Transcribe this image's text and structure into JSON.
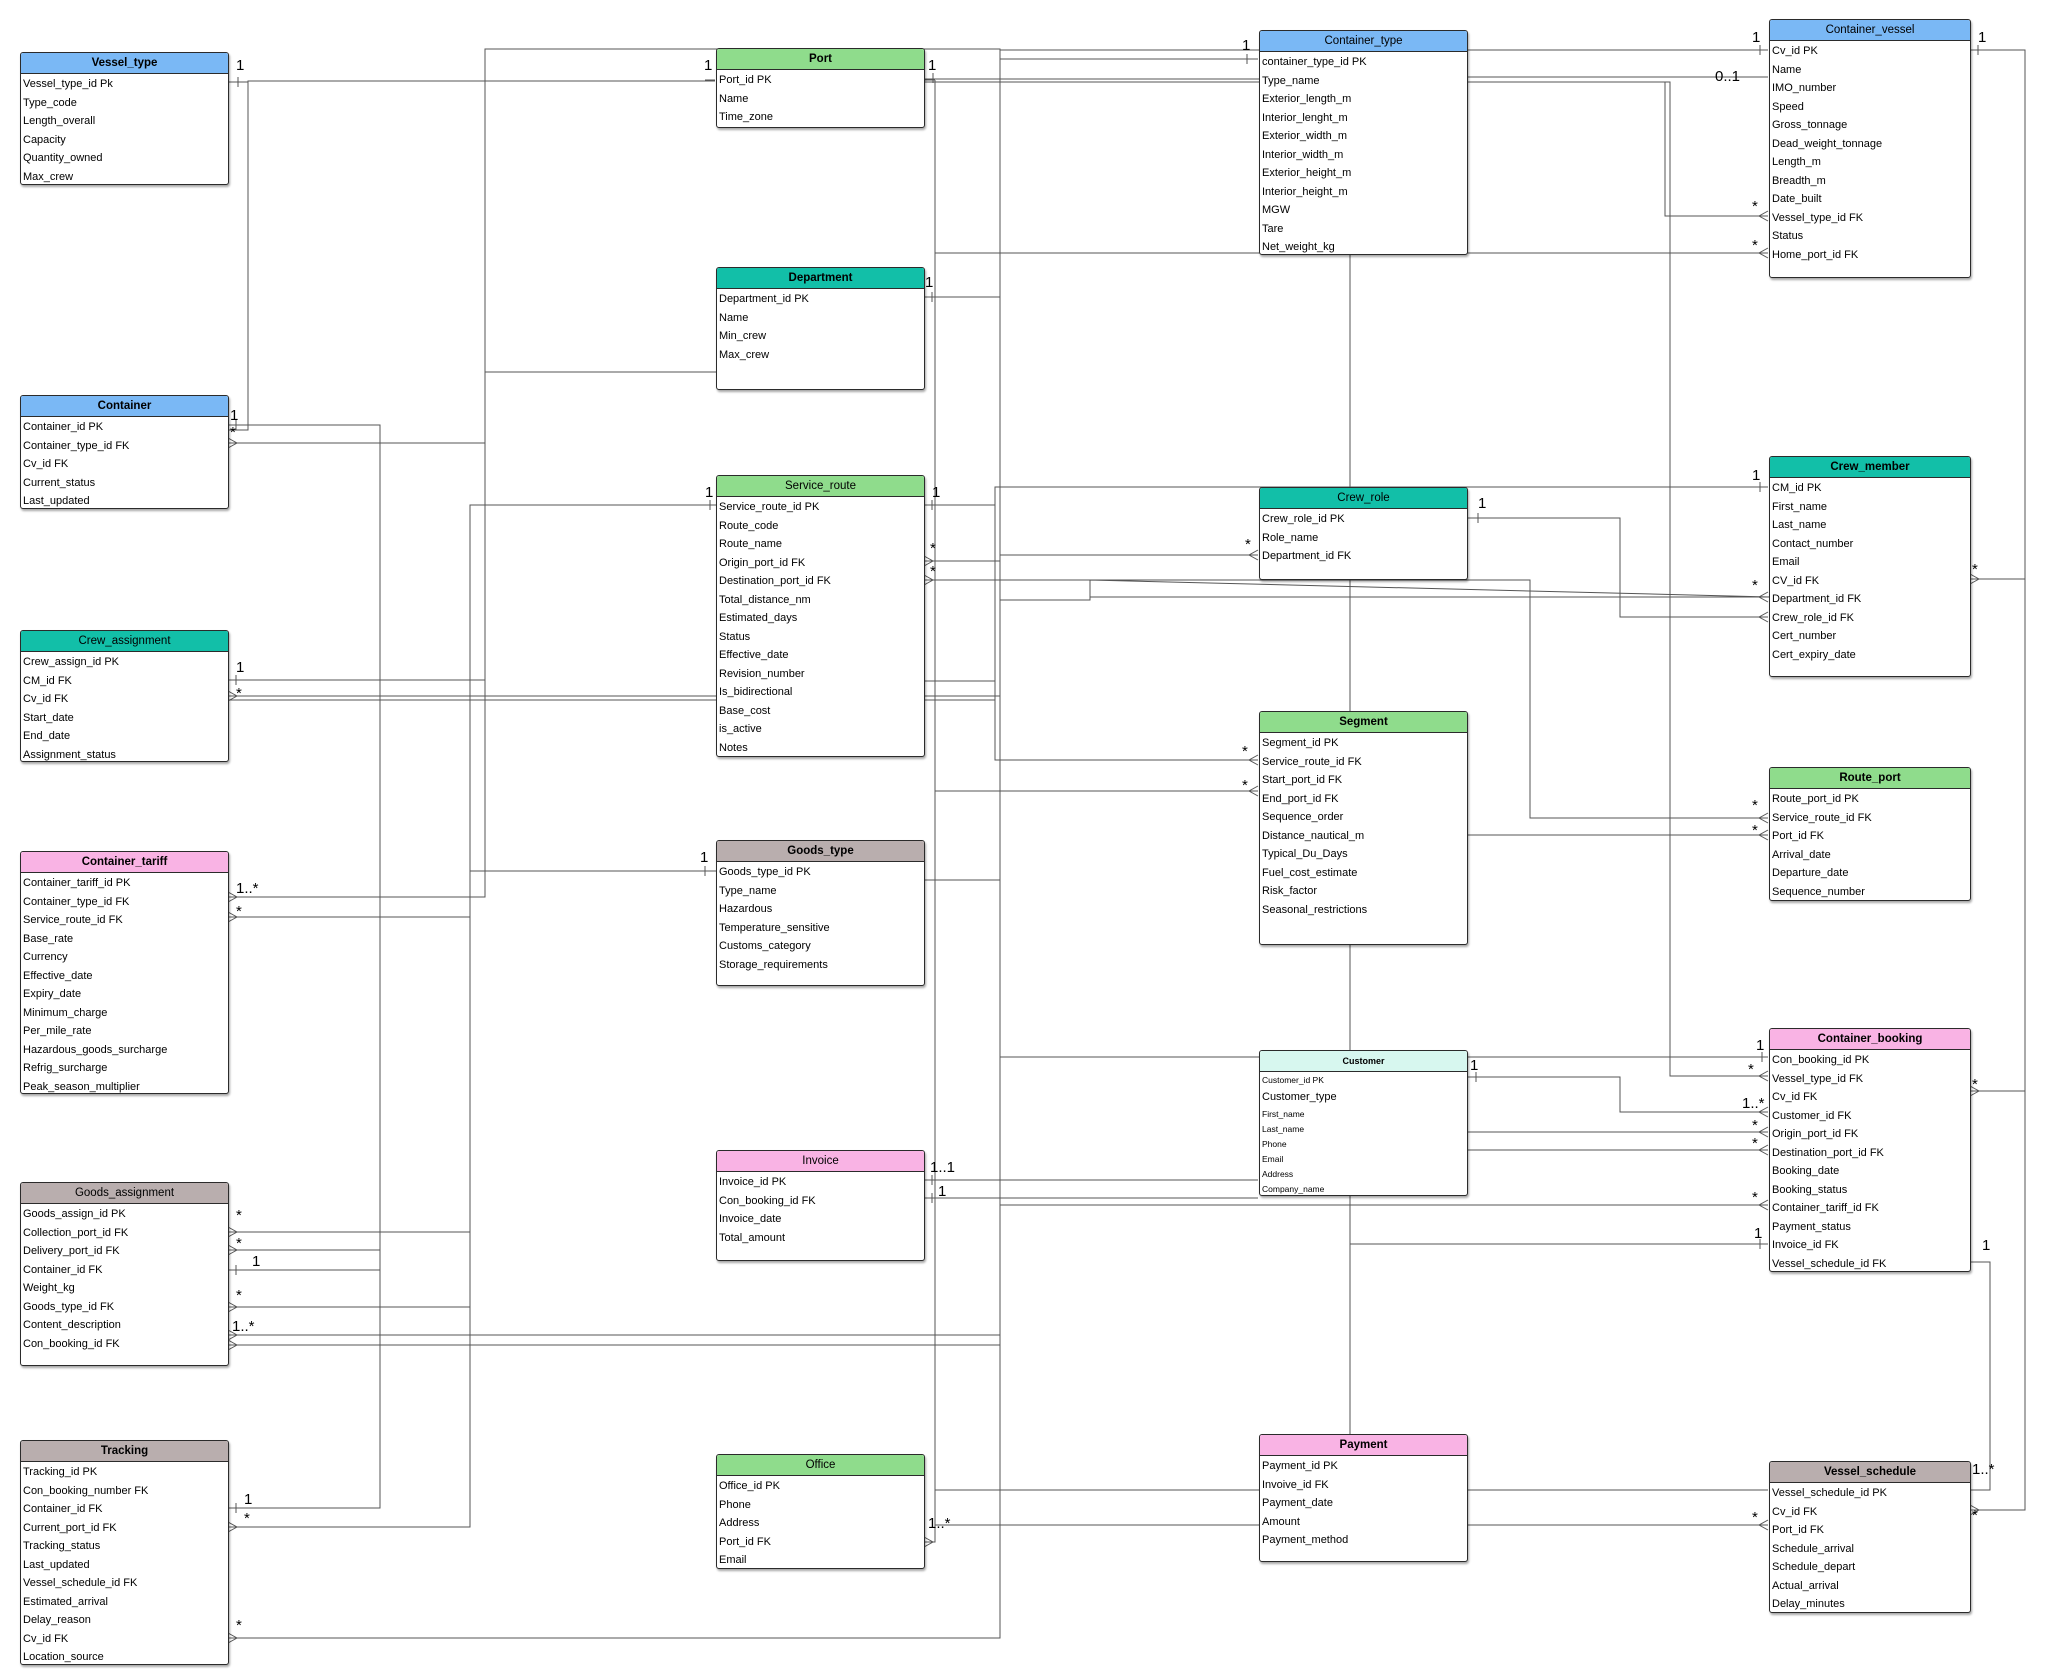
{
  "colors": {
    "blue": "#7ab8f5",
    "green": "#8fdc8c",
    "teal": "#12bfa8",
    "pink": "#f9b3e4",
    "gray": "#b9aeae",
    "mint": "#d7f7ef",
    "line": "#555555"
  },
  "entities": {
    "vessel_type": {
      "title": "Vessel_type",
      "color": "blue",
      "fields": [
        "Vessel_type_id Pk",
        "Type_code",
        "Length_overall",
        "Capacity",
        "Quantity_owned",
        "Max_crew"
      ]
    },
    "port": {
      "title": "Port",
      "color": "green",
      "fields": [
        "Port_id PK",
        "Name",
        "Time_zone"
      ]
    },
    "container_type": {
      "title": "Container_type",
      "color": "blue",
      "fields": [
        "container_type_id PK",
        "Type_name",
        "Exterior_length_m",
        "Interior_lenght_m",
        "Exterior_width_m",
        "Interior_width_m",
        "Exterior_height_m",
        "Interior_height_m",
        "MGW",
        "Tare",
        "Net_weight_kg"
      ]
    },
    "container_vessel": {
      "title": "Container_vessel",
      "color": "blue",
      "fields": [
        "Cv_id PK",
        "Name",
        "IMO_number",
        "Speed",
        "Gross_tonnage",
        "Dead_weight_tonnage",
        "Length_m",
        "Breadth_m",
        "Date_built",
        "Vessel_type_id FK",
        "Status",
        "Home_port_id FK"
      ]
    },
    "department": {
      "title": "Department",
      "color": "teal",
      "fields": [
        "Department_id PK",
        "Name",
        "Min_crew",
        "Max_crew"
      ]
    },
    "container": {
      "title": "Container",
      "color": "blue",
      "fields": [
        "Container_id PK",
        "Container_type_id FK",
        "Cv_id FK",
        "Current_status",
        "Last_updated"
      ]
    },
    "service_route": {
      "title": "Service_route",
      "color": "green",
      "fields": [
        "Service_route_id PK",
        "Route_code",
        "Route_name",
        "Origin_port_id FK",
        "Destination_port_id FK",
        "Total_distance_nm",
        "Estimated_days",
        "Status",
        "Effective_date",
        "Revision_number",
        "Is_bidirectional",
        "Base_cost",
        "is_active",
        "Notes"
      ]
    },
    "crew_role": {
      "title": "Crew_role",
      "color": "teal",
      "fields": [
        "Crew_role_id PK",
        "Role_name",
        "Department_id FK"
      ]
    },
    "crew_member": {
      "title": "Crew_member",
      "color": "teal",
      "fields": [
        "CM_id PK",
        "First_name",
        "Last_name",
        "Contact_number",
        "Email",
        "CV_id FK",
        "Department_id FK",
        "Crew_role_id FK",
        "Cert_number",
        "Cert_expiry_date"
      ]
    },
    "crew_assignment": {
      "title": "Crew_assignment",
      "color": "teal",
      "fields": [
        "Crew_assign_id PK",
        "CM_id FK",
        "Cv_id FK",
        "Start_date",
        "End_date",
        "Assignment_status"
      ]
    },
    "segment": {
      "title": "Segment",
      "color": "green",
      "fields": [
        "Segment_id PK",
        "Service_route_id FK",
        "Start_port_id FK",
        "End_port_id FK",
        "Sequence_order",
        "Distance_nautical_m",
        "Typical_Du_Days",
        "Fuel_cost_estimate",
        "Risk_factor",
        "Seasonal_restrictions"
      ]
    },
    "route_port": {
      "title": "Route_port",
      "color": "green",
      "fields": [
        "Route_port_id PK",
        "Service_route_id FK",
        "Port_id FK",
        "Arrival_date",
        "Departure_date",
        "Sequence_number"
      ]
    },
    "container_tariff": {
      "title": "Container_tariff",
      "color": "pink",
      "fields": [
        "Container_tariff_id PK",
        "Container_type_id FK",
        "Service_route_id FK",
        "Base_rate",
        "Currency",
        "Effective_date",
        "Expiry_date",
        "Minimum_charge",
        "Per_mile_rate",
        "Hazardous_goods_surcharge",
        "Refrig_surcharge",
        "Peak_season_multiplier"
      ]
    },
    "goods_type": {
      "title": "Goods_type",
      "color": "gray",
      "fields": [
        "Goods_type_id PK",
        "Type_name",
        "Hazardous",
        "Temperature_sensitive",
        "Customs_category",
        "Storage_requirements"
      ]
    },
    "customer": {
      "title": "Customer",
      "color": "mint",
      "fields": [
        "Customer_id PK",
        "Customer_type",
        "First_name",
        "Last_name",
        "Phone",
        "Email",
        "Address",
        "Company_name"
      ]
    },
    "container_booking": {
      "title": "Container_booking",
      "color": "pink",
      "fields": [
        "Con_booking_id PK",
        "Vessel_type_id FK",
        "Cv_id FK",
        "Customer_id FK",
        "Origin_port_id FK",
        "Destination_port_id FK",
        "Booking_date",
        "Booking_status",
        "Container_tariff_id FK",
        "Payment_status",
        "Invoice_id FK",
        "Vessel_schedule_id FK"
      ]
    },
    "goods_assignment": {
      "title": "Goods_assignment",
      "color": "gray",
      "fields": [
        "Goods_assign_id PK",
        "Collection_port_id  FK",
        "Delivery_port_id FK",
        "Container_id FK",
        "Weight_kg",
        "Goods_type_id FK",
        "Content_description",
        "Con_booking_id FK"
      ]
    },
    "invoice": {
      "title": "Invoice",
      "color": "pink",
      "fields": [
        "Invoice_id PK",
        "Con_booking_id FK",
        "Invoice_date",
        "Total_amount"
      ]
    },
    "tracking": {
      "title": "Tracking",
      "color": "gray",
      "fields": [
        "Tracking_id PK",
        "Con_booking_number FK",
        "Container_id FK",
        "Current_port_id  FK",
        "Tracking_status",
        "Last_updated",
        "Vessel_schedule_id FK",
        "Estimated_arrival",
        "Delay_reason",
        "Cv_id FK",
        "Location_source"
      ]
    },
    "office": {
      "title": "Office",
      "color": "green",
      "fields": [
        "Office_id PK",
        "Phone",
        "Address",
        "Port_id FK",
        "Email"
      ]
    },
    "payment": {
      "title": "Payment",
      "color": "pink",
      "fields": [
        "Payment_id PK",
        "Invoive_id FK",
        "Payment_date",
        "Amount",
        "Payment_method"
      ]
    },
    "vessel_schedule": {
      "title": "Vessel_schedule",
      "color": "gray",
      "fields": [
        "Vessel_schedule_id PK",
        "Cv_id FK",
        "Port_id FK",
        "Schedule_arrival",
        "Schedule_depart",
        "Actual_arrival",
        "Delay_minutes"
      ]
    }
  },
  "cardinality_labels": [
    "1",
    "*",
    "0..1",
    "1..*",
    "1..1"
  ]
}
